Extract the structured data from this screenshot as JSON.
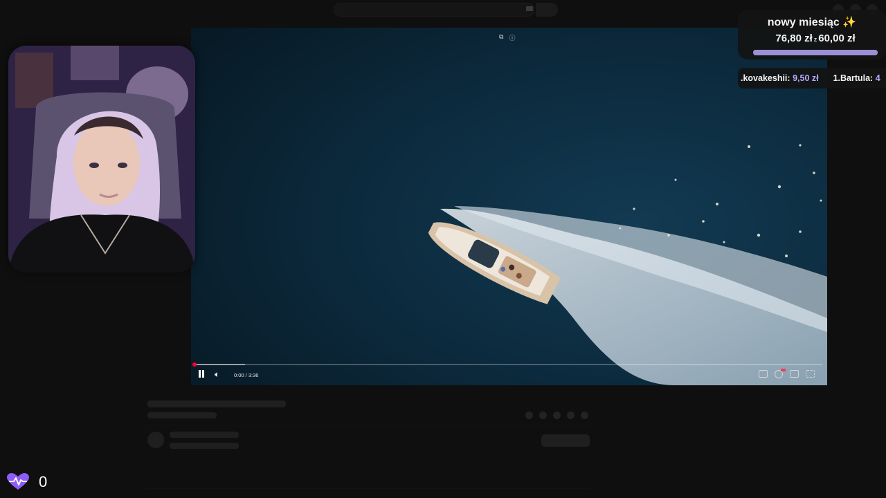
{
  "window": {
    "title": ""
  },
  "video": {
    "time_label": "0:00 / 3:36",
    "progress_fraction": 0.0,
    "buffered_fraction": 0.08,
    "top_icons": [
      "⧉",
      "ⓘ"
    ],
    "icons": {
      "play_state": "pause-icon",
      "volume": "volume-icon",
      "controls_right": [
        "subtitles-icon",
        "settings-icon",
        "miniplayer-icon",
        "fullscreen-icon"
      ]
    }
  },
  "goal_widget": {
    "title": "nowy miesiąc ✨",
    "current": "76,80 zł",
    "separator": "z",
    "target": "60,00 zł",
    "progress_fraction": 1.0,
    "bar_color": "#9a90d6"
  },
  "ticker": {
    "entries": [
      {
        "name": ".kovakeshii:",
        "amount": "9,50 zł"
      },
      {
        "name": "1.Bartula:",
        "amount": "4"
      }
    ],
    "amount_color": "#b9a7ff"
  },
  "heartbeat_counter": {
    "icon": "heartbeat-icon",
    "value": "0",
    "icon_color": "#8e5cf7"
  }
}
